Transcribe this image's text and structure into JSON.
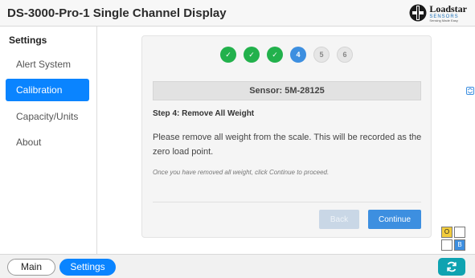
{
  "header": {
    "title": "DS-3000-Pro-1 Single Channel Display",
    "logo": {
      "name": "Loadstar",
      "subtitle": "SENSORS",
      "tagline": "Sensing Made Easy"
    }
  },
  "sidebar": {
    "heading": "Settings",
    "items": [
      {
        "label": "Alert System",
        "active": false
      },
      {
        "label": "Calibration",
        "active": true
      },
      {
        "label": "Capacity/Units",
        "active": false
      },
      {
        "label": "About",
        "active": false
      }
    ]
  },
  "wizard": {
    "steps": [
      {
        "label": "✓",
        "state": "done"
      },
      {
        "label": "✓",
        "state": "done"
      },
      {
        "label": "✓",
        "state": "done"
      },
      {
        "label": "4",
        "state": "current"
      },
      {
        "label": "5",
        "state": "todo"
      },
      {
        "label": "6",
        "state": "todo"
      }
    ],
    "sensor": "Sensor: 5M-28125",
    "step_title": "Step 4: Remove All Weight",
    "instruction": "Please remove all weight from the scale. This will be recorded as the zero load point.",
    "hint": "Once you have removed all weight, click Continue to proceed.",
    "back_label": "Back",
    "continue_label": "Continue"
  },
  "grid_indicator": {
    "cells": [
      "O",
      "",
      "",
      "B"
    ]
  },
  "footer": {
    "tabs": [
      {
        "label": "Main"
      },
      {
        "label": "Settings"
      }
    ]
  },
  "colors": {
    "accent": "#0a84ff",
    "step_done": "#22b14c",
    "step_current": "#3d8fe0",
    "refresh": "#0fa3b1"
  },
  "icons": {
    "edge": "expand-icon",
    "refresh": "refresh-icon"
  }
}
